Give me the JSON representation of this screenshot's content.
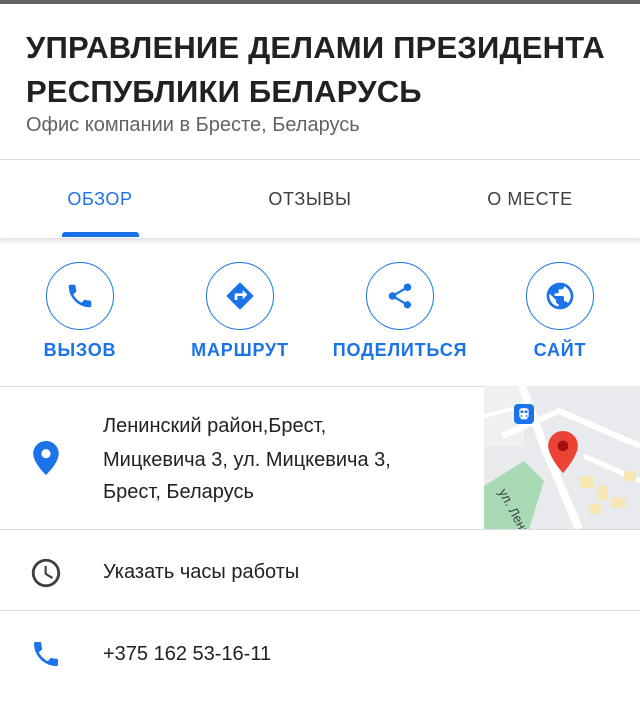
{
  "place": {
    "name": "УПРАВЛЕНИЕ ДЕЛАМИ ПРЕЗИДЕНТА РЕСПУБЛИКИ БЕЛАРУСЬ",
    "category": "Офис компании в Бресте, Беларусь"
  },
  "tabs": [
    {
      "label": "ОБЗОР",
      "active": true
    },
    {
      "label": "ОТЗЫВЫ",
      "active": false
    },
    {
      "label": "О МЕСТЕ",
      "active": false
    }
  ],
  "actions": [
    {
      "label": "ВЫЗОВ",
      "icon": "phone-icon"
    },
    {
      "label": "МАРШРУТ",
      "icon": "directions-icon"
    },
    {
      "label": "ПОДЕЛИТЬСЯ",
      "icon": "share-icon"
    },
    {
      "label": "САЙТ",
      "icon": "globe-icon"
    }
  ],
  "details": {
    "address": {
      "lines": [
        "Ленинский район,Брест,",
        "Мицкевича 3, ул. Мицкевича 3,",
        "Брест, Беларусь"
      ],
      "icon": "location-pin-icon"
    },
    "hours": {
      "text": "Указать часы работы",
      "icon": "clock-icon"
    },
    "phone": {
      "text": "+375 162 53-16-11",
      "icon": "phone-icon"
    }
  },
  "map_thumbnail": {
    "street_label": "ул. Ленина",
    "icons": [
      "transit-icon",
      "map-pin-icon"
    ]
  },
  "colors": {
    "accent": "#1a73e8",
    "pin_red": "#ea4335",
    "text_primary": "#202124",
    "text_secondary": "#5f6368",
    "divider": "#dadce0"
  }
}
